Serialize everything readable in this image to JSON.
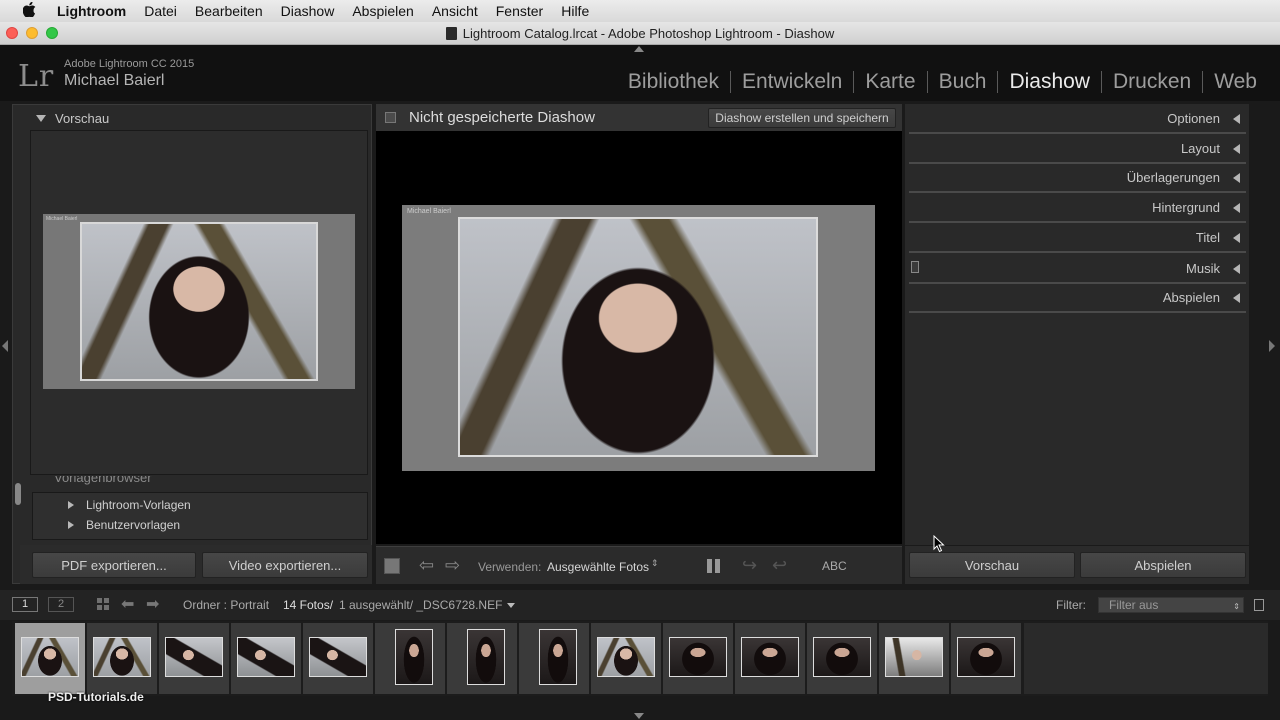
{
  "menubar": {
    "apple": "",
    "app": "Lightroom",
    "items": [
      "Datei",
      "Bearbeiten",
      "Diashow",
      "Abspielen",
      "Ansicht",
      "Fenster",
      "Hilfe"
    ]
  },
  "window": {
    "title": "Lightroom Catalog.lrcat - Adobe Photoshop Lightroom - Diashow"
  },
  "identity": {
    "logo": "Lr",
    "product": "Adobe Lightroom CC 2015",
    "user": "Michael Baierl"
  },
  "modules": [
    "Bibliothek",
    "Entwickeln",
    "Karte",
    "Buch",
    "Diashow",
    "Drucken",
    "Web"
  ],
  "active_module": "Diashow",
  "left_panel": {
    "preview_header": "Vorschau",
    "template_browser_header": "Vorlagenbrowser",
    "templates": [
      "Lightroom-Vorlagen",
      "Benutzervorlagen"
    ],
    "export_pdf": "PDF exportieren...",
    "export_video": "Video exportieren..."
  },
  "center": {
    "title": "Nicht gespeicherte Diashow",
    "create_button": "Diashow erstellen und speichern",
    "slide_watermark": "Michael Baierl",
    "toolbar": {
      "use_label": "Verwenden:",
      "use_value": "Ausgewählte Fotos",
      "selector": "⇕",
      "text_overlay": "ABC"
    }
  },
  "right_panel": {
    "sections": [
      "Optionen",
      "Layout",
      "Überlagerungen",
      "Hintergrund",
      "Titel",
      "Musik",
      "Abspielen"
    ],
    "preview_button": "Vorschau",
    "play_button": "Abspielen"
  },
  "filmstrip_header": {
    "view1": "1",
    "view2": "2",
    "folder": "Ordner : Portrait",
    "count": "14 Fotos/",
    "selection": "1 ausgewählt/ _DSC6728.NEF",
    "filter_label": "Filter:",
    "filter_value": "Filter aus",
    "stepper": "⇕"
  },
  "filmstrip": {
    "thumbnail_count": 14,
    "selected_index": 0
  },
  "watermark": "PSD-Tutorials.de"
}
